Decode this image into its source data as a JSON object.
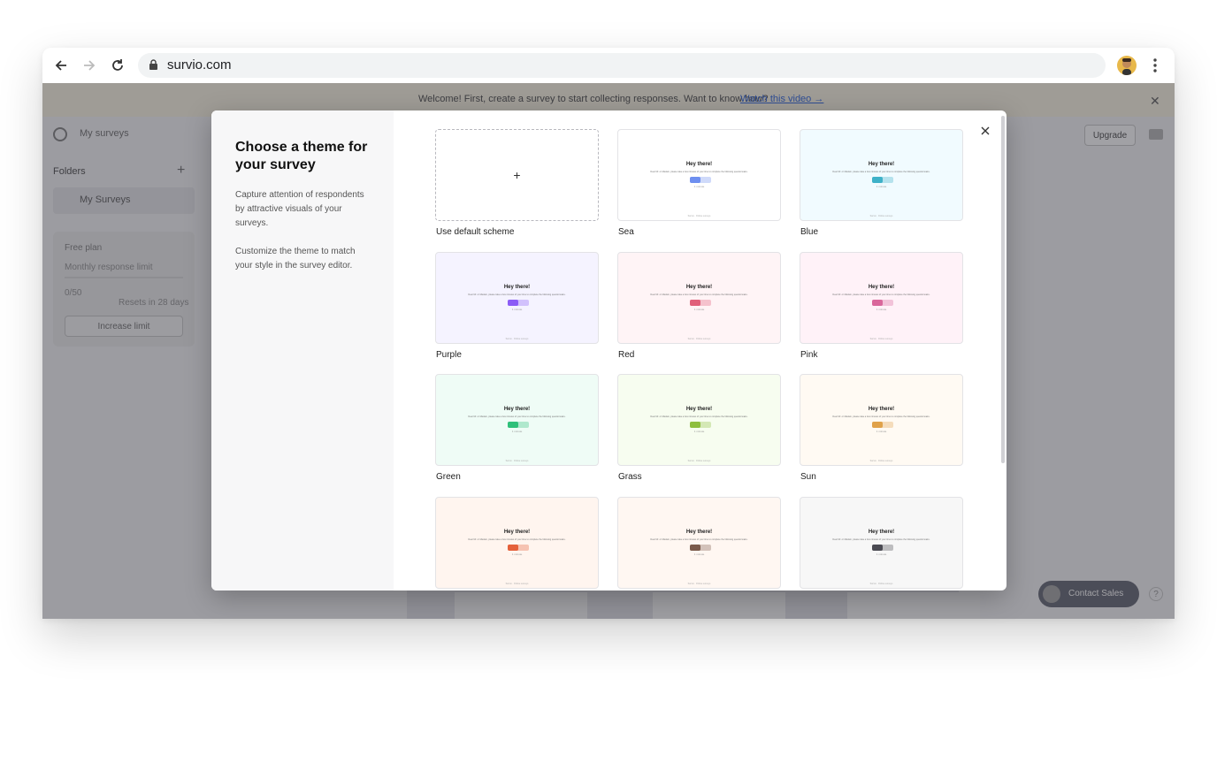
{
  "browser": {
    "url": "survio.com",
    "back_icon": "arrow-left-icon",
    "forward_icon": "arrow-right-icon",
    "reload_icon": "reload-icon"
  },
  "app": {
    "banner_text": "Welcome! First, create a survey to start collecting responses. Want to know how?",
    "banner_link": "Watch this video →",
    "breadcrumb": "My surveys",
    "upgrade_label": "Upgrade",
    "folders_label": "Folders",
    "my_surveys_label": "My Surveys",
    "plan_title": "Free plan",
    "plan_limit_label": "Monthly response limit",
    "plan_value": "0/50",
    "plan_reset": "Resets in 28 days",
    "increase_label": "Increase limit",
    "contact_label": "Contact Sales",
    "help_label": "?"
  },
  "modal": {
    "title": "Choose a theme for your survey",
    "description1": "Capture attention of respondents by attractive visuals of your surveys.",
    "description2": "Customize the theme to match your style in the survey editor.",
    "default_label": "Use default scheme",
    "preview_heading": "Hey there!",
    "preview_sub": "Dear Mr. or Madam, please take a few minutes of your time to complete the following questionnaire.",
    "preview_start": "Start",
    "preview_info": "1 minute",
    "preview_footer": "Survio · Online surveys",
    "themes": [
      {
        "label": "Sea",
        "bg": "#ffffff",
        "accent": "#6e8ff0"
      },
      {
        "label": "Blue",
        "bg": "#f1fbff",
        "accent": "#3eb1c8"
      },
      {
        "label": "Purple",
        "bg": "#f5f3ff",
        "accent": "#8b5cf6"
      },
      {
        "label": "Red",
        "bg": "#fff4f6",
        "accent": "#e0607a"
      },
      {
        "label": "Pink",
        "bg": "#fff2f8",
        "accent": "#d9679b"
      },
      {
        "label": "Green",
        "bg": "#effcf6",
        "accent": "#2fc07a"
      },
      {
        "label": "Grass",
        "bg": "#f7fdf0",
        "accent": "#8fbf3f"
      },
      {
        "label": "Sun",
        "bg": "#fffaf3",
        "accent": "#e0a24a"
      },
      {
        "label": "",
        "bg": "#fff5ef",
        "accent": "#e5603a"
      },
      {
        "label": "",
        "bg": "#fff7f2",
        "accent": "#7a5a4a"
      },
      {
        "label": "",
        "bg": "#f7f7f7",
        "accent": "#4a4a52"
      }
    ]
  }
}
